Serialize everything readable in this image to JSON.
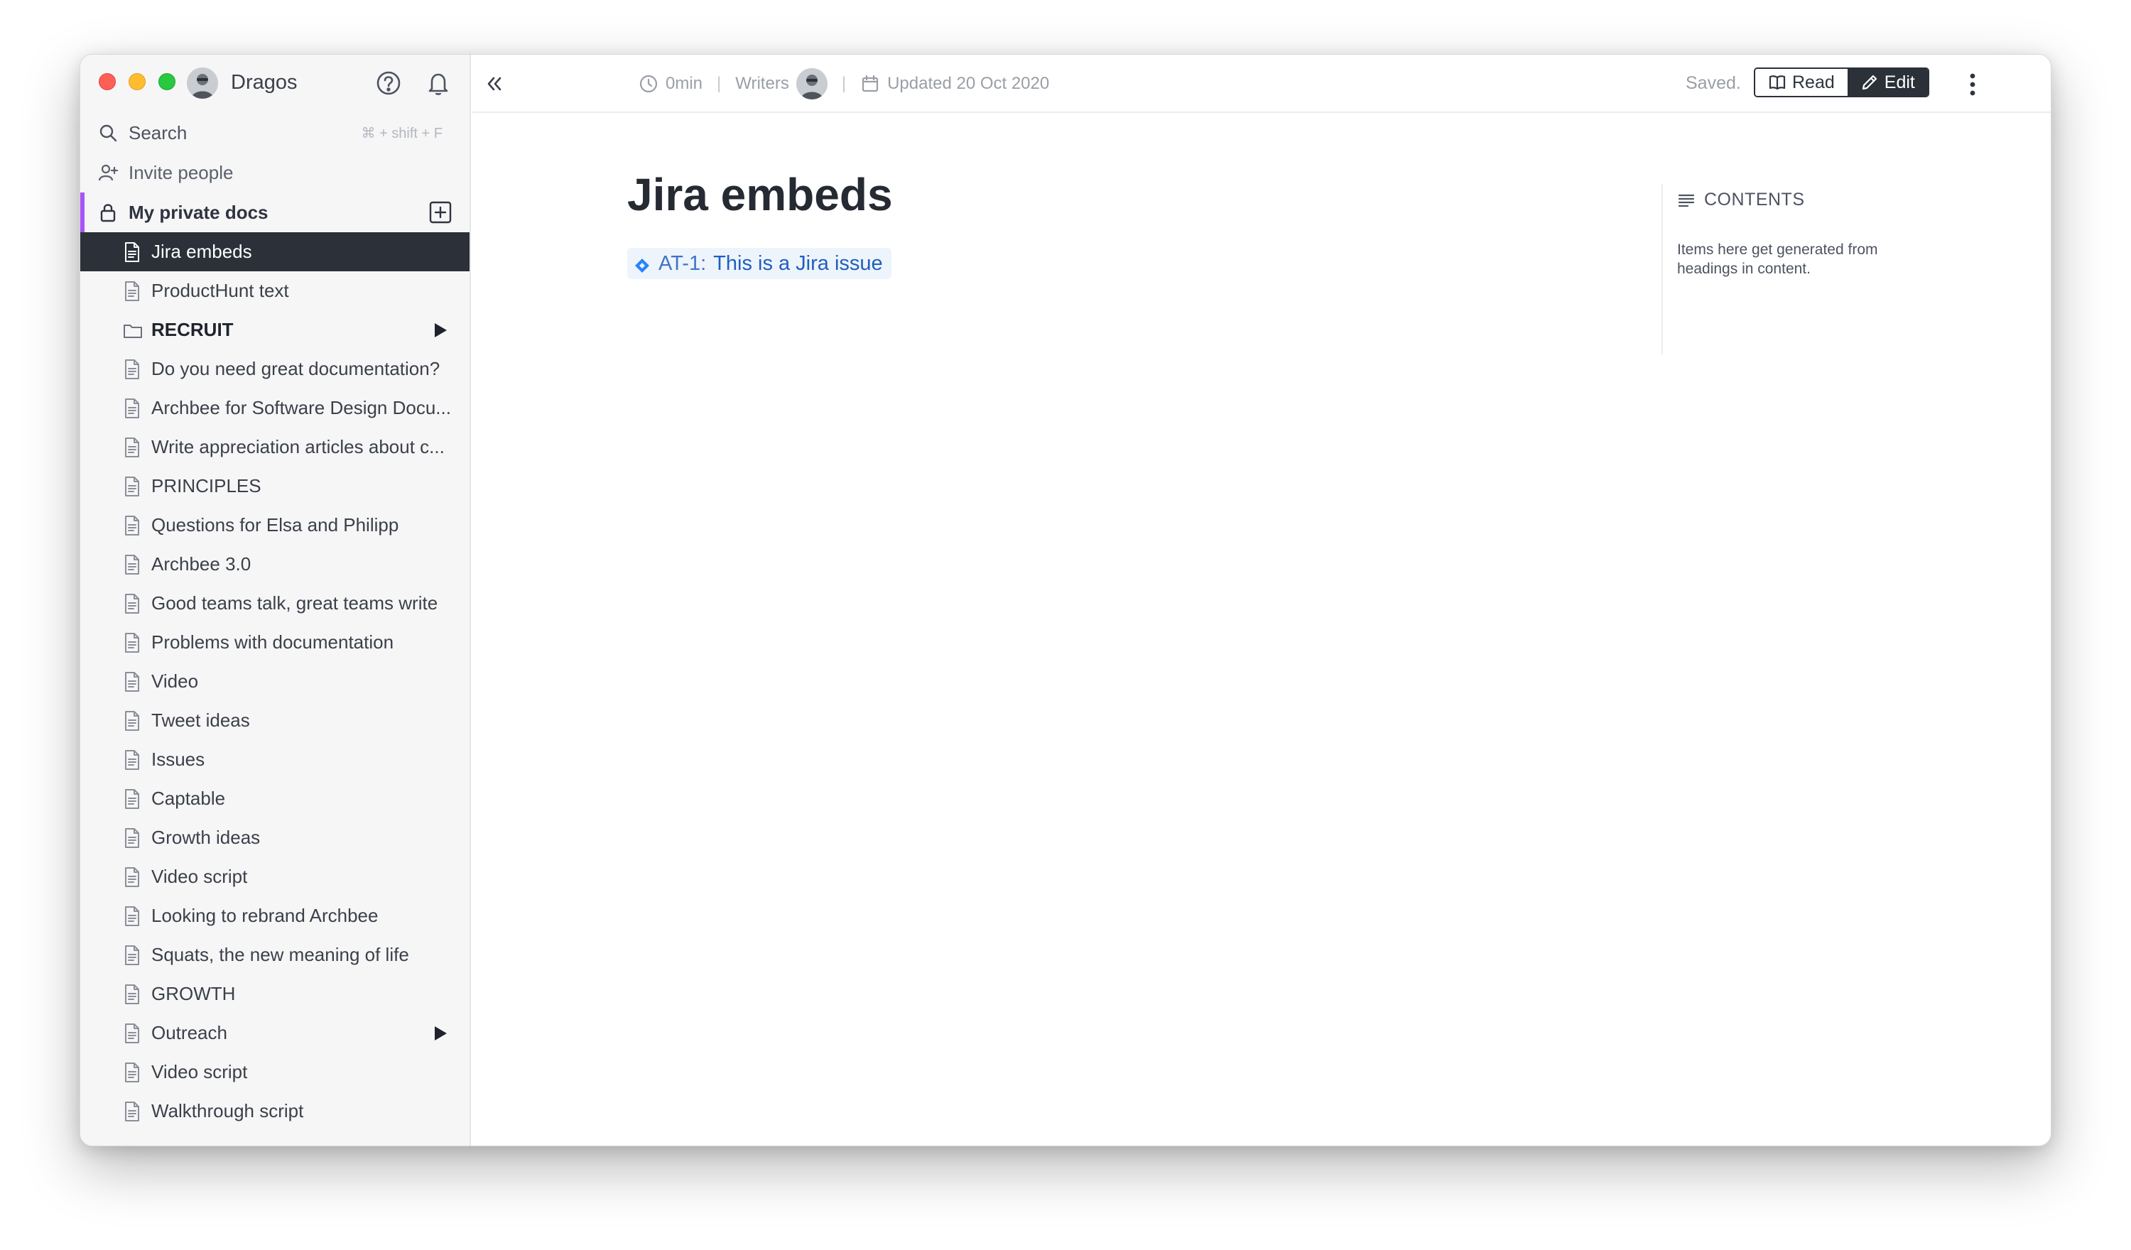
{
  "sidebar": {
    "user_name": "Dragos",
    "search": {
      "label": "Search",
      "shortcut": "⌘ + shift + F"
    },
    "invite_label": "Invite people",
    "section_label": "My private docs",
    "items": [
      {
        "label": "Jira embeds",
        "active": true
      },
      {
        "label": "ProductHunt text"
      },
      {
        "label": "RECRUIT",
        "folder": true,
        "expandable": true
      },
      {
        "label": "Do you need great documentation?"
      },
      {
        "label": "Archbee for Software Design Docu..."
      },
      {
        "label": "Write appreciation articles about c..."
      },
      {
        "label": "PRINCIPLES"
      },
      {
        "label": "Questions for Elsa and Philipp"
      },
      {
        "label": "Archbee 3.0"
      },
      {
        "label": "Good teams talk, great teams write"
      },
      {
        "label": "Problems with documentation"
      },
      {
        "label": "Video"
      },
      {
        "label": "Tweet ideas"
      },
      {
        "label": "Issues"
      },
      {
        "label": "Captable"
      },
      {
        "label": "Growth ideas"
      },
      {
        "label": "Video script"
      },
      {
        "label": "Looking to rebrand Archbee"
      },
      {
        "label": "Squats, the new meaning of life"
      },
      {
        "label": "GROWTH"
      },
      {
        "label": "Outreach",
        "expandable": true
      },
      {
        "label": "Video script"
      },
      {
        "label": "Walkthrough script"
      }
    ]
  },
  "topbar": {
    "read_time": "0min",
    "writers_label": "Writers",
    "updated": "Updated 20 Oct 2020",
    "saved_status": "Saved.",
    "read_label": "Read",
    "edit_label": "Edit"
  },
  "document": {
    "title": "Jira embeds",
    "jira_key": "AT-1:",
    "jira_summary": "This is a Jira issue"
  },
  "toc": {
    "heading": "CONTENTS",
    "hint": "Items here get generated from headings in content."
  },
  "colors": {
    "accent_purple": "#a855f7",
    "active_item_bg": "#2b3039",
    "jira_blue": "#1f5fbf"
  }
}
